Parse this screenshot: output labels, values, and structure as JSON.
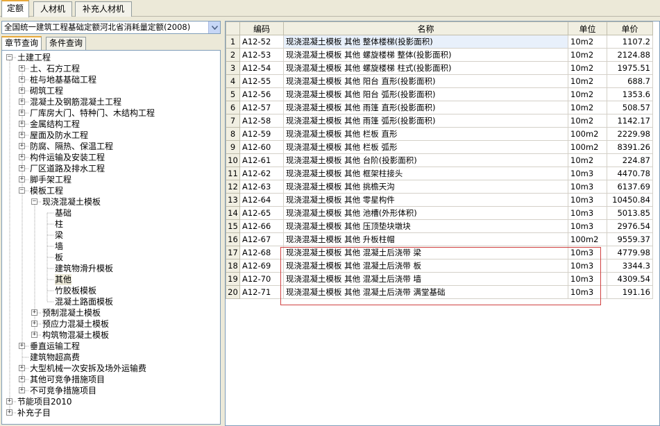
{
  "top_tabs": [
    "定额",
    "人材机",
    "补充人材机"
  ],
  "dropdown": {
    "value": "全国统一建筑工程基础定额河北省消耗量定额(2008)"
  },
  "sub_tabs": [
    "章节查询",
    "条件查询"
  ],
  "tree": [
    {
      "label": "土建工程",
      "level": 0,
      "exp": "-"
    },
    {
      "label": "土、石方工程",
      "level": 1,
      "exp": "+"
    },
    {
      "label": "桩与地基基础工程",
      "level": 1,
      "exp": "+"
    },
    {
      "label": "砌筑工程",
      "level": 1,
      "exp": "+"
    },
    {
      "label": "混凝土及钢筋混凝土工程",
      "level": 1,
      "exp": "+"
    },
    {
      "label": "厂库房大门、特种门、木结构工程",
      "level": 1,
      "exp": "+"
    },
    {
      "label": "金属结构工程",
      "level": 1,
      "exp": "+"
    },
    {
      "label": "屋面及防水工程",
      "level": 1,
      "exp": "+"
    },
    {
      "label": "防腐、隔热、保温工程",
      "level": 1,
      "exp": "+"
    },
    {
      "label": "构件运输及安装工程",
      "level": 1,
      "exp": "+"
    },
    {
      "label": "厂区道路及排水工程",
      "level": 1,
      "exp": "+"
    },
    {
      "label": "脚手架工程",
      "level": 1,
      "exp": "+"
    },
    {
      "label": "模板工程",
      "level": 1,
      "exp": "-"
    },
    {
      "label": "现浇混凝土模板",
      "level": 2,
      "exp": "-"
    },
    {
      "label": "基础",
      "level": 3,
      "exp": ""
    },
    {
      "label": "柱",
      "level": 3,
      "exp": ""
    },
    {
      "label": "梁",
      "level": 3,
      "exp": ""
    },
    {
      "label": "墙",
      "level": 3,
      "exp": ""
    },
    {
      "label": "板",
      "level": 3,
      "exp": ""
    },
    {
      "label": "建筑物滑升模板",
      "level": 3,
      "exp": ""
    },
    {
      "label": "其他",
      "level": 3,
      "exp": "",
      "selected": true
    },
    {
      "label": "竹胶板模板",
      "level": 3,
      "exp": ""
    },
    {
      "label": "混凝土路面模板",
      "level": 3,
      "exp": ""
    },
    {
      "label": "预制混凝土模板",
      "level": 2,
      "exp": "+"
    },
    {
      "label": "预应力混凝土模板",
      "level": 2,
      "exp": "+"
    },
    {
      "label": "构筑物混凝土模板",
      "level": 2,
      "exp": "+"
    },
    {
      "label": "垂直运输工程",
      "level": 1,
      "exp": "+"
    },
    {
      "label": "建筑物超高费",
      "level": 1,
      "exp": ""
    },
    {
      "label": "大型机械一次安拆及场外运输费",
      "level": 1,
      "exp": "+"
    },
    {
      "label": "其他可竞争措施项目",
      "level": 1,
      "exp": "+"
    },
    {
      "label": "不可竞争措施项目",
      "level": 1,
      "exp": "+"
    },
    {
      "label": "节能项目2010",
      "level": 0,
      "exp": "+"
    },
    {
      "label": "补充子目",
      "level": 0,
      "exp": "+"
    }
  ],
  "grid": {
    "headers": [
      "",
      "编码",
      "名称",
      "单位",
      "单价"
    ],
    "rows": [
      {
        "n": "1",
        "code": "A12-52",
        "name": "现浇混凝土模板 其他 整体楼梯(投影面积)",
        "unit": "10m2",
        "price": "1107.2"
      },
      {
        "n": "2",
        "code": "A12-53",
        "name": "现浇混凝土模板 其他 螺旋楼梯 整体(投影面积)",
        "unit": "10m2",
        "price": "2124.88"
      },
      {
        "n": "3",
        "code": "A12-54",
        "name": "现浇混凝土模板 其他 螺旋楼梯 柱式(投影面积)",
        "unit": "10m2",
        "price": "1975.51"
      },
      {
        "n": "4",
        "code": "A12-55",
        "name": "现浇混凝土模板 其他 阳台 直形(投影面积)",
        "unit": "10m2",
        "price": "688.7"
      },
      {
        "n": "5",
        "code": "A12-56",
        "name": "现浇混凝土模板 其他 阳台 弧形(投影面积)",
        "unit": "10m2",
        "price": "1353.6"
      },
      {
        "n": "6",
        "code": "A12-57",
        "name": "现浇混凝土模板 其他 雨篷 直形(投影面积)",
        "unit": "10m2",
        "price": "508.57"
      },
      {
        "n": "7",
        "code": "A12-58",
        "name": "现浇混凝土模板 其他 雨篷 弧形(投影面积)",
        "unit": "10m2",
        "price": "1142.17"
      },
      {
        "n": "8",
        "code": "A12-59",
        "name": "现浇混凝土模板 其他 栏板 直形",
        "unit": "100m2",
        "price": "2229.98"
      },
      {
        "n": "9",
        "code": "A12-60",
        "name": "现浇混凝土模板 其他 栏板 弧形",
        "unit": "100m2",
        "price": "8391.26"
      },
      {
        "n": "10",
        "code": "A12-61",
        "name": "现浇混凝土模板 其他 台阶(投影面积)",
        "unit": "10m2",
        "price": "224.87"
      },
      {
        "n": "11",
        "code": "A12-62",
        "name": "现浇混凝土模板 其他 框架柱接头",
        "unit": "10m3",
        "price": "4470.78"
      },
      {
        "n": "12",
        "code": "A12-63",
        "name": "现浇混凝土模板 其他 挑檐天沟",
        "unit": "10m3",
        "price": "6137.69"
      },
      {
        "n": "13",
        "code": "A12-64",
        "name": "现浇混凝土模板 其他 零星构件",
        "unit": "10m3",
        "price": "10450.84"
      },
      {
        "n": "14",
        "code": "A12-65",
        "name": "现浇混凝土模板 其他 池槽(外形体积)",
        "unit": "10m3",
        "price": "5013.85"
      },
      {
        "n": "15",
        "code": "A12-66",
        "name": "现浇混凝土模板 其他 压顶垫块墩块",
        "unit": "10m3",
        "price": "2976.54"
      },
      {
        "n": "16",
        "code": "A12-67",
        "name": "现浇混凝土模板 其他 升板柱帽",
        "unit": "100m2",
        "price": "9559.37"
      },
      {
        "n": "17",
        "code": "A12-68",
        "name": "现浇混凝土模板 其他 混凝土后浇带 梁",
        "unit": "10m3",
        "price": "4779.98"
      },
      {
        "n": "18",
        "code": "A12-69",
        "name": "现浇混凝土模板 其他 混凝土后浇带 板",
        "unit": "10m3",
        "price": "3344.3"
      },
      {
        "n": "19",
        "code": "A12-70",
        "name": "现浇混凝土模板 其他 混凝土后浇带 墙",
        "unit": "10m3",
        "price": "4309.54"
      },
      {
        "n": "20",
        "code": "A12-71",
        "name": "现浇混凝土模板 其他 混凝土后浇带 满堂基础",
        "unit": "10m3",
        "price": "191.16"
      }
    ]
  },
  "colors": {
    "highlight_box": "#d04040",
    "selected_tab_accent": "#e8a838"
  }
}
